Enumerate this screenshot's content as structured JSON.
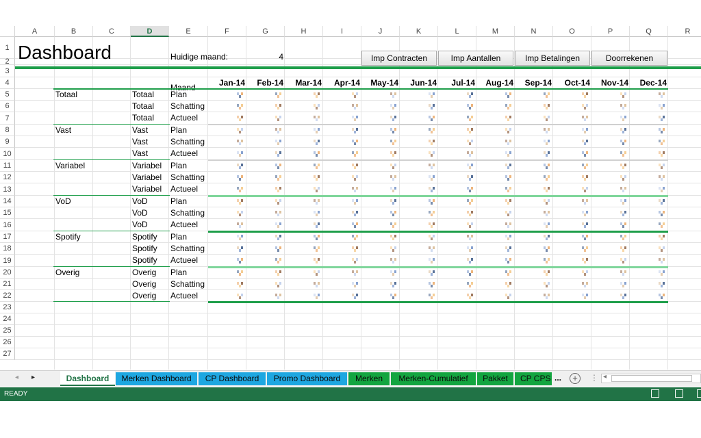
{
  "columns": [
    "A",
    "B",
    "C",
    "D",
    "E",
    "F",
    "G",
    "H",
    "I",
    "J",
    "K",
    "L",
    "M",
    "N",
    "O",
    "P",
    "Q",
    "R"
  ],
  "selected_column": "D",
  "rows": [
    "1",
    "2",
    "3",
    "4",
    "5",
    "6",
    "7",
    "8",
    "9",
    "10",
    "11",
    "12",
    "13",
    "14",
    "15",
    "16",
    "17",
    "18",
    "19",
    "20",
    "21",
    "22",
    "23",
    "24",
    "25",
    "26",
    "27"
  ],
  "title": "Dashboard",
  "current_month_label": "Huidige maand:",
  "current_month_value": "4",
  "buttons": [
    "Imp Contracten",
    "Imp Aantallen",
    "Imp Betalingen",
    "Doorrekenen"
  ],
  "month_header": "Maand",
  "months": [
    "Jan-14",
    "Feb-14",
    "Mar-14",
    "Apr-14",
    "May-14",
    "Jun-14",
    "Jul-14",
    "Aug-14",
    "Sep-14",
    "Oct-14",
    "Nov-14",
    "Dec-14"
  ],
  "groups": [
    {
      "name": "Totaal",
      "rows": [
        {
          "cat": "Totaal",
          "type": "Plan"
        },
        {
          "cat": "Totaal",
          "type": "Schatting"
        },
        {
          "cat": "Totaal",
          "type": "Actueel"
        }
      ]
    },
    {
      "name": "Vast",
      "rows": [
        {
          "cat": "Vast",
          "type": "Plan"
        },
        {
          "cat": "Vast",
          "type": "Schatting"
        },
        {
          "cat": "Vast",
          "type": "Actueel"
        }
      ]
    },
    {
      "name": "Variabel",
      "rows": [
        {
          "cat": "Variabel",
          "type": "Plan"
        },
        {
          "cat": "Variabel",
          "type": "Schatting"
        },
        {
          "cat": "Variabel",
          "type": "Actueel"
        }
      ]
    },
    {
      "name": "VoD",
      "rows": [
        {
          "cat": "VoD",
          "type": "Plan"
        },
        {
          "cat": "VoD",
          "type": "Schatting"
        },
        {
          "cat": "VoD",
          "type": "Actueel"
        }
      ]
    },
    {
      "name": "Spotify",
      "rows": [
        {
          "cat": "Spotify",
          "type": "Plan"
        },
        {
          "cat": "Spotify",
          "type": "Schatting"
        },
        {
          "cat": "Spotify",
          "type": "Actueel"
        }
      ]
    },
    {
      "name": "Overig",
      "rows": [
        {
          "cat": "Overig",
          "type": "Plan"
        },
        {
          "cat": "Overig",
          "type": "Schatting"
        },
        {
          "cat": "Overig",
          "type": "Actueel"
        }
      ]
    }
  ],
  "sheet_tabs": [
    {
      "label": "Dashboard",
      "style": "active"
    },
    {
      "label": "Merken Dashboard",
      "style": "blue"
    },
    {
      "label": "CP Dashboard",
      "style": "blue"
    },
    {
      "label": "Promo Dashboard",
      "style": "blue"
    },
    {
      "label": "Merken",
      "style": "green"
    },
    {
      "label": "Merken-Cumulatief",
      "style": "green"
    },
    {
      "label": "Pakket",
      "style": "green"
    },
    {
      "label": "CP CPS",
      "style": "green"
    }
  ],
  "more_tabs": "...",
  "status": "READY",
  "colors": {
    "excel_green": "#217346",
    "accent_green": "#1e9e4a",
    "tab_blue": "#1ea7e1",
    "tab_green": "#13a540"
  }
}
